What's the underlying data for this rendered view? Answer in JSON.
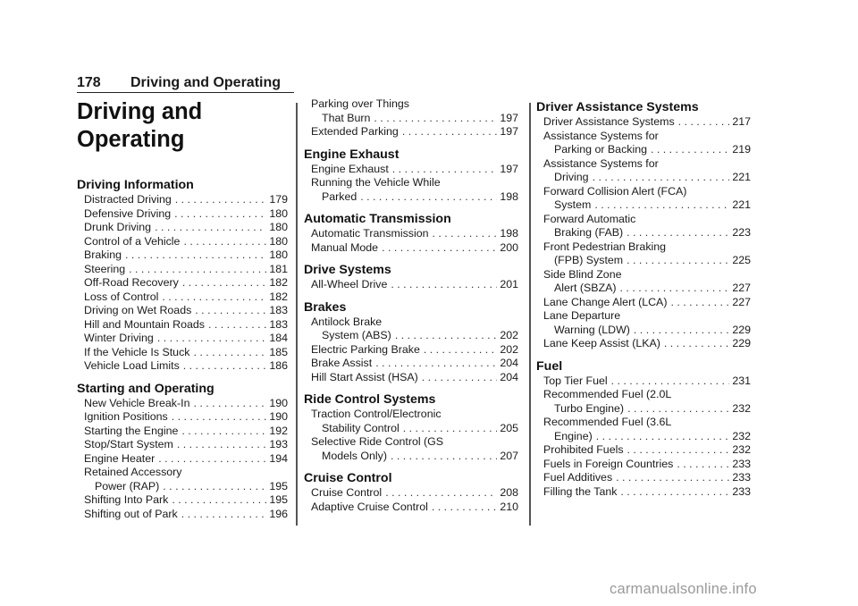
{
  "header": {
    "page_number": "178",
    "title": "Driving and Operating"
  },
  "chapter_title_line1": "Driving and",
  "chapter_title_line2": "Operating",
  "columns": [
    {
      "sections": [
        {
          "title": "Driving Information",
          "entries": [
            {
              "text": "Distracted Driving",
              "page": "179"
            },
            {
              "text": "Defensive Driving",
              "page": "180"
            },
            {
              "text": "Drunk Driving",
              "page": "180"
            },
            {
              "text": "Control of a Vehicle",
              "page": "180"
            },
            {
              "text": "Braking",
              "page": "180"
            },
            {
              "text": "Steering",
              "page": "181"
            },
            {
              "text": "Off-Road Recovery",
              "page": "182"
            },
            {
              "text": "Loss of Control",
              "page": "182"
            },
            {
              "text": "Driving on Wet Roads",
              "page": "183"
            },
            {
              "text": "Hill and Mountain Roads",
              "page": "183"
            },
            {
              "text": "Winter Driving",
              "page": "184"
            },
            {
              "text": "If the Vehicle Is Stuck",
              "page": "185"
            },
            {
              "text": "Vehicle Load Limits",
              "page": "186"
            }
          ]
        },
        {
          "title": "Starting and Operating",
          "entries": [
            {
              "text": "New Vehicle Break-In",
              "page": "190"
            },
            {
              "text": "Ignition Positions",
              "page": "190"
            },
            {
              "text": "Starting the Engine",
              "page": "192"
            },
            {
              "text": "Stop/Start System",
              "page": "193"
            },
            {
              "text": "Engine Heater",
              "page": "194"
            },
            {
              "text_line1": "Retained Accessory",
              "text": "Power (RAP)",
              "page": "195"
            },
            {
              "text": "Shifting Into Park",
              "page": "195"
            },
            {
              "text": "Shifting out of Park",
              "page": "196"
            }
          ]
        }
      ]
    },
    {
      "sections": [
        {
          "title": "",
          "entries": [
            {
              "text_line1": "Parking over Things",
              "text": "That Burn",
              "page": "197"
            },
            {
              "text": "Extended Parking",
              "page": "197"
            }
          ]
        },
        {
          "title": "Engine Exhaust",
          "entries": [
            {
              "text": "Engine Exhaust",
              "page": "197"
            },
            {
              "text_line1": "Running the Vehicle While",
              "text": "Parked",
              "page": "198"
            }
          ]
        },
        {
          "title": "Automatic Transmission",
          "entries": [
            {
              "text": "Automatic Transmission",
              "page": "198"
            },
            {
              "text": "Manual Mode",
              "page": "200"
            }
          ]
        },
        {
          "title": "Drive Systems",
          "entries": [
            {
              "text": "All-Wheel Drive",
              "page": "201"
            }
          ]
        },
        {
          "title": "Brakes",
          "entries": [
            {
              "text_line1": "Antilock Brake",
              "text": "System (ABS)",
              "page": "202"
            },
            {
              "text": "Electric Parking Brake",
              "page": "202"
            },
            {
              "text": "Brake Assist",
              "page": "204"
            },
            {
              "text": "Hill Start Assist (HSA)",
              "page": "204"
            }
          ]
        },
        {
          "title": "Ride Control Systems",
          "entries": [
            {
              "text_line1": "Traction Control/Electronic",
              "text": "Stability Control",
              "page": "205"
            },
            {
              "text_line1": "Selective Ride Control (GS",
              "text": "Models Only)",
              "page": "207"
            }
          ]
        },
        {
          "title": "Cruise Control",
          "entries": [
            {
              "text": "Cruise Control",
              "page": "208"
            },
            {
              "text": "Adaptive Cruise Control",
              "page": "210"
            }
          ]
        }
      ]
    },
    {
      "sections": [
        {
          "title": "Driver Assistance Systems",
          "entries": [
            {
              "text": "Driver Assistance Systems",
              "page": "217"
            },
            {
              "text_line1": "Assistance Systems for",
              "text": "Parking or Backing",
              "page": "219"
            },
            {
              "text_line1": "Assistance Systems for",
              "text": "Driving",
              "page": "221"
            },
            {
              "text_line1": "Forward Collision Alert (FCA)",
              "text": "System",
              "page": "221"
            },
            {
              "text_line1": "Forward Automatic",
              "text": "Braking (FAB)",
              "page": "223"
            },
            {
              "text_line1": "Front Pedestrian Braking",
              "text": "(FPB) System",
              "page": "225"
            },
            {
              "text_line1": "Side Blind Zone",
              "text": "Alert (SBZA)",
              "page": "227"
            },
            {
              "text": "Lane Change Alert (LCA)",
              "page": "227"
            },
            {
              "text_line1": "Lane Departure",
              "text": "Warning (LDW)",
              "page": "229"
            },
            {
              "text": "Lane Keep Assist (LKA)",
              "page": "229"
            }
          ]
        },
        {
          "title": "Fuel",
          "entries": [
            {
              "text": "Top Tier Fuel",
              "page": "231"
            },
            {
              "text_line1": "Recommended Fuel (2.0L",
              "text": "Turbo Engine)",
              "page": "232"
            },
            {
              "text_line1": "Recommended Fuel (3.6L",
              "text": "Engine)",
              "page": "232"
            },
            {
              "text": "Prohibited Fuels",
              "page": "232"
            },
            {
              "text": "Fuels in Foreign Countries",
              "page": "233"
            },
            {
              "text": "Fuel Additives",
              "page": "233"
            },
            {
              "text": "Filling the Tank",
              "page": "233"
            }
          ]
        }
      ]
    }
  ],
  "watermark": "carmanualsonline.info"
}
